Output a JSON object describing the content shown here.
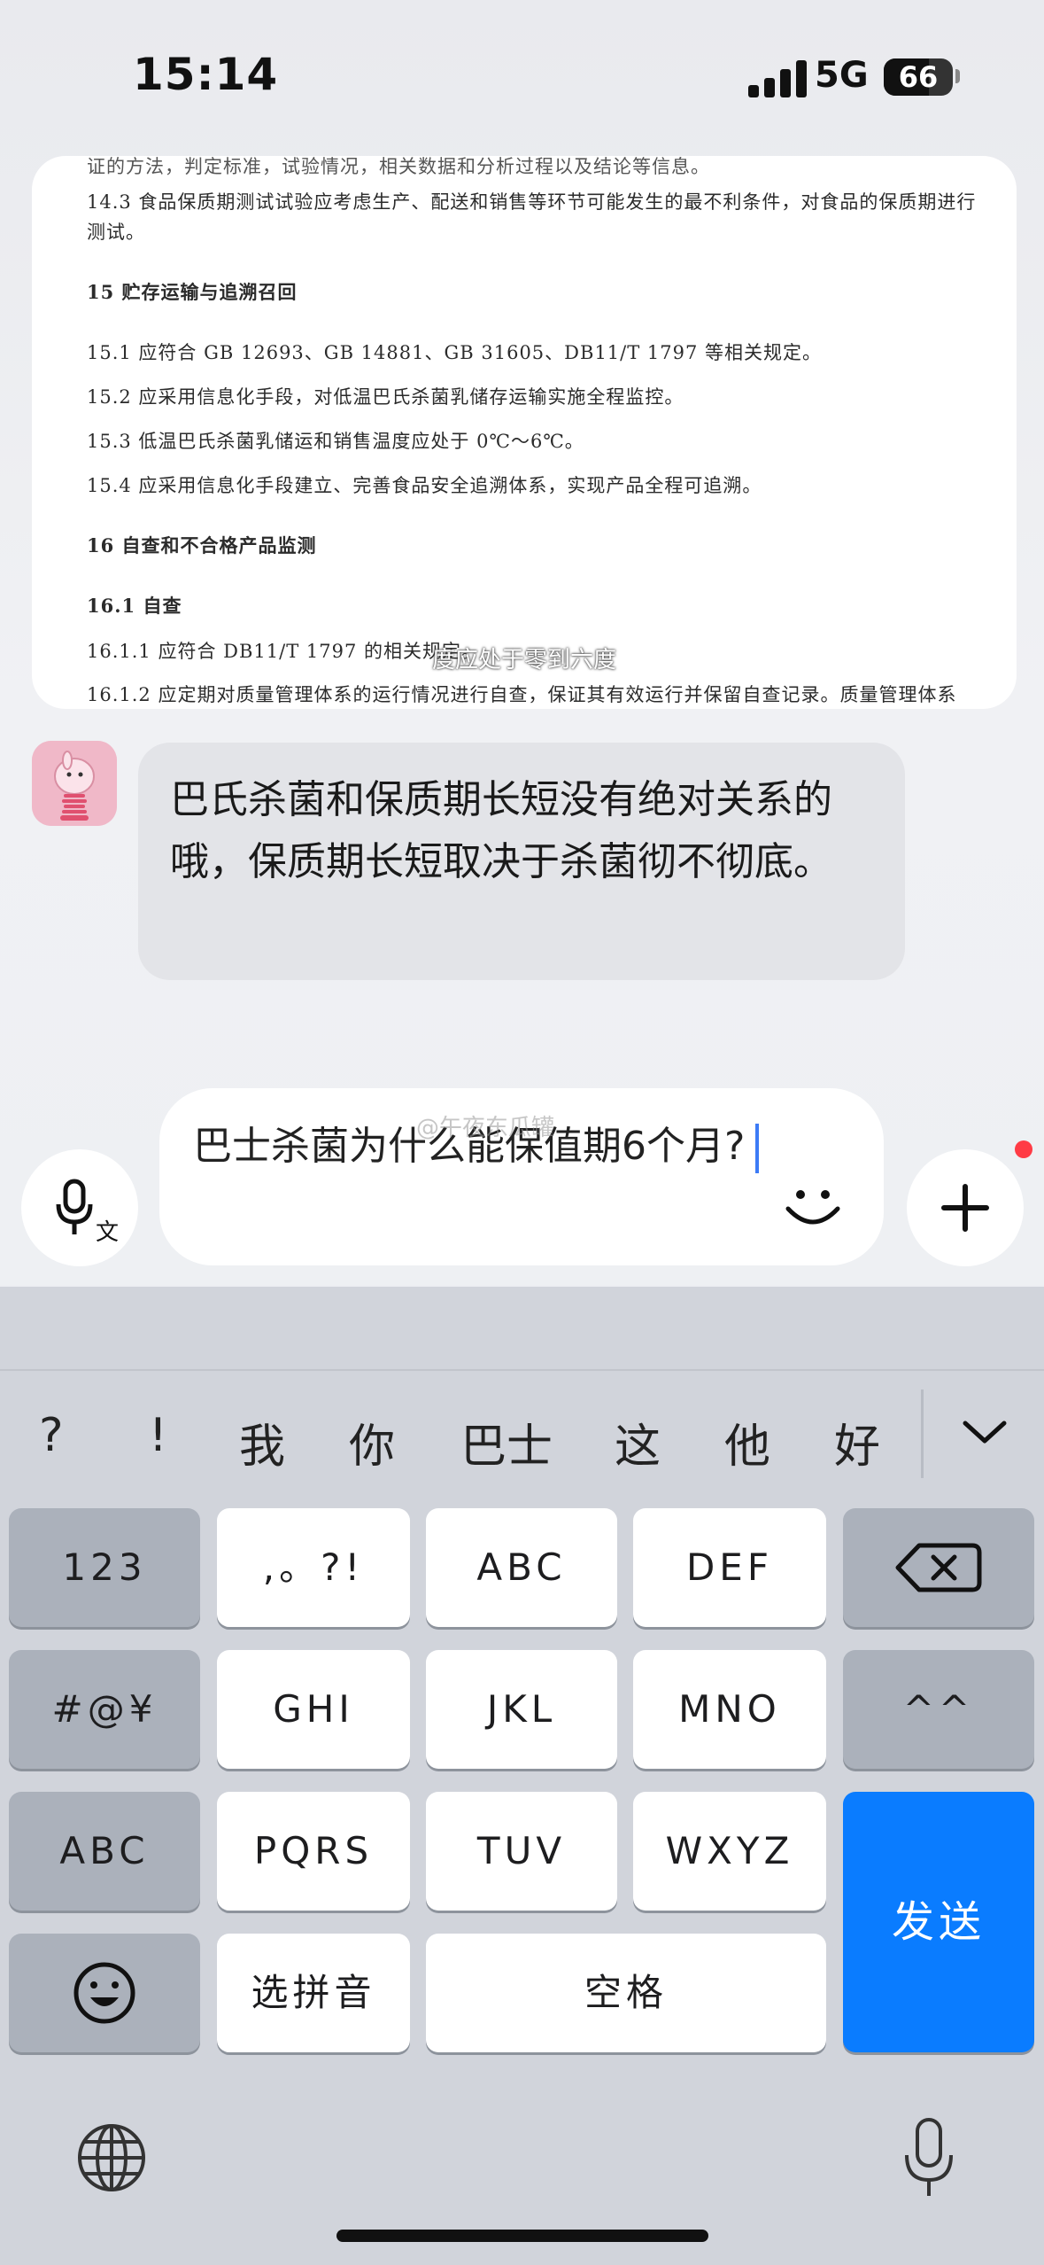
{
  "status_bar": {
    "time": "15:14",
    "network": "5G",
    "battery": "66"
  },
  "document_card": {
    "lines": [
      {
        "text": "证的方法，判定标准，试验情况，相关数据和分析过程以及结论等信息。"
      },
      {
        "text": "14.3   食品保质期测试试验应考虑生产、配送和销售等环节可能发生的最不利条件，对食品的保质期进行"
      },
      {
        "text": "测试。"
      },
      {
        "text": "15   贮存运输与追溯召回"
      },
      {
        "text": "15.1   应符合 GB 12693、GB 14881、GB 31605、DB11/T 1797 等相关规定。"
      },
      {
        "text": "15.2   应采用信息化手段，对低温巴氏杀菌乳储存运输实施全程监控。"
      },
      {
        "text": "15.3   低温巴氏杀菌乳储运和销售温度应处于 0℃～6℃。"
      },
      {
        "text": "15.4   应采用信息化手段建立、完善食品安全追溯体系，实现产品全程可追溯。"
      },
      {
        "text": "16   自查和不合格产品监测"
      },
      {
        "text": "16.1   自查"
      },
      {
        "text": "16.1.1   应符合 DB11/T 1797 的相关规定。"
      },
      {
        "text": "16.1.2   应定期对质量管理体系的运行情况进行自查，保证其有效运行并保留自查记录。质量管理体系"
      }
    ],
    "caption": "度应处于零到六度"
  },
  "chat": {
    "reply_text": "巴氏杀菌和保质期长短没有绝对关系的哦，保质期长短取决于杀菌彻不彻底。"
  },
  "input": {
    "value": "巴士杀菌为什么能保值期6个月?",
    "watermark": "@午夜东瓜罐"
  },
  "keyboard": {
    "candidates": [
      "?",
      "!",
      "我",
      "你",
      "巴士",
      "这",
      "他",
      "好"
    ],
    "keys": {
      "num": "123",
      "punct": ",。?!",
      "abc": "ABC",
      "def": "DEF",
      "symbols": "#@¥",
      "ghi": "GHI",
      "jkl": "JKL",
      "mno": "MNO",
      "caret": "^^",
      "abc_switch": "ABC",
      "pqrs": "PQRS",
      "tuv": "TUV",
      "wxyz": "WXYZ",
      "send": "发送",
      "pinyin": "选拼音",
      "space": "空格"
    }
  },
  "colors": {
    "send_key": "#0a7cff",
    "caret": "#3c7bf6",
    "notification_dot": "#ff3b45"
  }
}
